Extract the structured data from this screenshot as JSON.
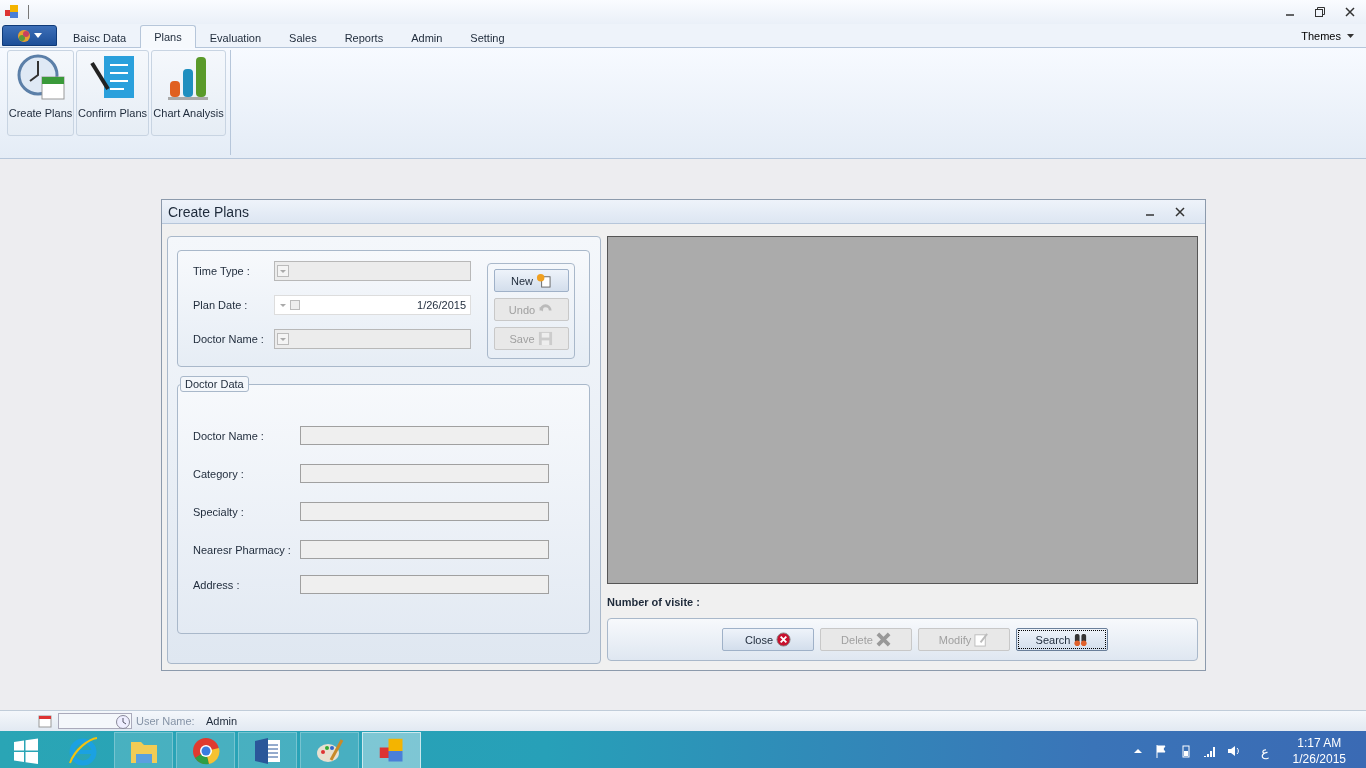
{
  "ribbon": {
    "tabs": [
      {
        "label": "Baisc Data",
        "selected": false
      },
      {
        "label": "Plans",
        "selected": true
      },
      {
        "label": "Evaluation",
        "selected": false
      },
      {
        "label": "Sales",
        "selected": false
      },
      {
        "label": "Reports",
        "selected": false
      },
      {
        "label": "Admin",
        "selected": false
      },
      {
        "label": "Setting",
        "selected": false
      }
    ],
    "themes": "Themes",
    "buttons": [
      {
        "label": "Create Plans",
        "kind": "clock"
      },
      {
        "label": "Confirm Plans",
        "kind": "checklist"
      },
      {
        "label": "Chart Analysis",
        "kind": "chart"
      }
    ]
  },
  "child_window": {
    "title": "Create Plans",
    "plan_fields": [
      {
        "label": "Time Type :",
        "kind": "combo"
      },
      {
        "label": "Plan Date :",
        "kind": "date",
        "value": "1/26/2015"
      },
      {
        "label": "Doctor Name :",
        "kind": "combo"
      }
    ],
    "actions": [
      {
        "label": "New",
        "kind": "new",
        "disabled": false
      },
      {
        "label": "Undo",
        "kind": "undo",
        "disabled": true
      },
      {
        "label": "Save",
        "kind": "save",
        "disabled": true
      }
    ],
    "doctor_data": {
      "legend": "Doctor Data",
      "fields": [
        {
          "label": "Doctor Name :"
        },
        {
          "label": "Category :"
        },
        {
          "label": "Specialty :"
        },
        {
          "label": "Nearesr Pharmacy :"
        },
        {
          "label": "Address :"
        }
      ]
    },
    "visits_label": "Number of visite :",
    "buttons": [
      {
        "label": "Close",
        "kind": "close",
        "disabled": false,
        "focused": false
      },
      {
        "label": "Delete",
        "kind": "delete",
        "disabled": true,
        "focused": false
      },
      {
        "label": "Modify",
        "kind": "modify",
        "disabled": true,
        "focused": false
      },
      {
        "label": "Search",
        "kind": "search",
        "disabled": false,
        "focused": true
      }
    ]
  },
  "status_bar": {
    "user_label": "User Name:",
    "user": "Admin"
  },
  "taskbar": {
    "apps": [
      {
        "kind": "explorer",
        "selected": false
      },
      {
        "kind": "chrome",
        "selected": false
      },
      {
        "kind": "word",
        "selected": false
      },
      {
        "kind": "paint",
        "selected": false
      },
      {
        "kind": "app",
        "selected": true
      }
    ],
    "language": "ع",
    "time": "1:17 AM",
    "date": "1/26/2015"
  }
}
